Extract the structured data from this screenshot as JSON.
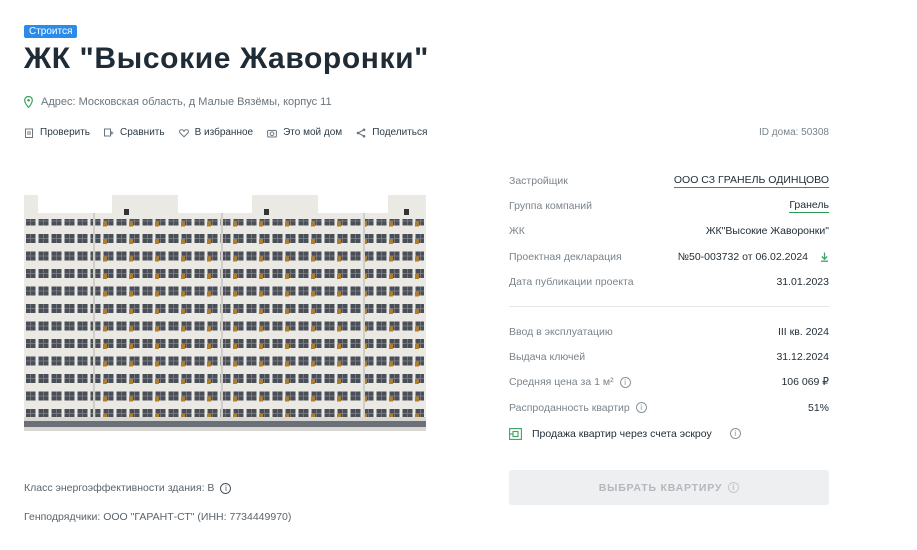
{
  "status_badge": "Строится",
  "title": "ЖК \"Высокие Жаворонки\"",
  "address": "Адрес: Московская область, д Малые Вязёмы, корпус 11",
  "actions": [
    {
      "label": "Проверить",
      "icon": "clipboard-icon"
    },
    {
      "label": "Сравнить",
      "icon": "compare-icon"
    },
    {
      "label": "В избранное",
      "icon": "heart-icon"
    },
    {
      "label": "Это мой дом",
      "icon": "camera-icon"
    },
    {
      "label": "Поделиться",
      "icon": "share-icon"
    }
  ],
  "house_id": "ID дома: 50308",
  "info": {
    "developer_label": "Застройщик",
    "developer_value": "ООО СЗ ГРАНЕЛЬ ОДИНЦОВО",
    "group_label": "Группа компаний",
    "group_value": "Гранель",
    "complex_label": "ЖК",
    "complex_value": "ЖК\"Высокие Жаворонки\"",
    "declaration_label": "Проектная декларация",
    "declaration_value": "№50-003732 от 06.02.2024",
    "publication_label": "Дата публикации проекта",
    "publication_value": "31.01.2023",
    "commissioning_label": "Ввод в эксплуатацию",
    "commissioning_value": "III кв. 2024",
    "keys_label": "Выдача ключей",
    "keys_value": "31.12.2024",
    "price_label": "Средняя цена за 1 м²",
    "price_value": "106 069 ₽",
    "sold_label": "Распроданность квартир",
    "sold_value": "51%",
    "escrow_text": "Продажа квартир через счета эскроу"
  },
  "choose_button": "ВЫБРАТЬ КВАРТИРУ",
  "energy_class": "Класс энергоэффективности здания: B",
  "contractors": "Генподрядчики: ООО \"ГАРАНТ-СТ\" (ИНН: 7734449970)",
  "colors": {
    "accent_blue": "#2a8be8",
    "link_green": "#2a9a55",
    "title": "#1f2b35"
  }
}
